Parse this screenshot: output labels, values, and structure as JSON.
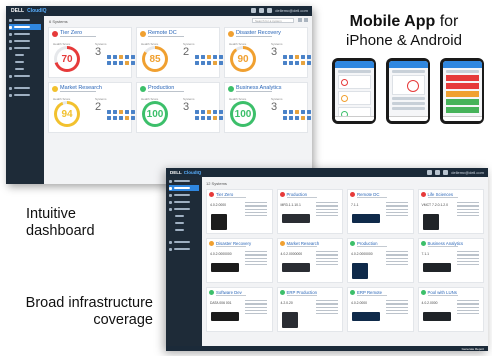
{
  "heading": {
    "bold": "Mobile App",
    "rest": " for",
    "line2": "iPhone & Android"
  },
  "captions": {
    "intuitive": [
      "Intuitive",
      "dashboard"
    ],
    "broad": [
      "Broad infrastructure",
      "coverage"
    ]
  },
  "brand": {
    "name": "DELL",
    "product": "CloudIQ"
  },
  "dash1": {
    "count": "6 Systems",
    "search_placeholder": "Search for a system",
    "sort": "Sort",
    "user": "dellemc@dell.com",
    "health_label": "Health Score",
    "inv_label": "Systems",
    "cards": [
      {
        "name": "Tier Zero",
        "score": "70",
        "inv": "3",
        "color": "#e63a3a"
      },
      {
        "name": "Remote DC",
        "score": "85",
        "inv": "2",
        "color": "#f0a030"
      },
      {
        "name": "Disaster Recovery",
        "score": "90",
        "inv": "3",
        "color": "#f0a030"
      },
      {
        "name": "Market Research",
        "score": "94",
        "inv": "2",
        "color": "#f2c12e"
      },
      {
        "name": "Production",
        "score": "100",
        "inv": "3",
        "color": "#3cbf6a"
      },
      {
        "name": "Business Analytics",
        "score": "100",
        "inv": "3",
        "color": "#3cbf6a"
      }
    ]
  },
  "dash2": {
    "count": "12 Systems",
    "footer_button": "Generate Report",
    "cards": [
      {
        "name": "Tier Zero",
        "ver": "4.0.2.0000",
        "color": "#e63a3a"
      },
      {
        "name": "Production",
        "ver": "MR3.1.1.10.1",
        "color": "#e63a3a"
      },
      {
        "name": "Remote DC",
        "ver": "7.1.1",
        "color": "#e63a3a"
      },
      {
        "name": "Life Sciences",
        "ver": "VMCT 7.2.0.1.2.0",
        "color": "#e63a3a"
      },
      {
        "name": "Disaster Recovery",
        "ver": "4.0.2.0000000",
        "color": "#f0a030"
      },
      {
        "name": "Market Research",
        "ver": "4.0.2.0000000",
        "color": "#f0a030"
      },
      {
        "name": "Production",
        "ver": "4.0.2.0000000",
        "color": "#3cbf6a"
      },
      {
        "name": "Business Analytics",
        "ver": "7.1.1",
        "color": "#3cbf6a"
      },
      {
        "name": "Software Dev",
        "ver": "DATA 006 001",
        "color": "#3cbf6a"
      },
      {
        "name": "ERP Production",
        "ver": "4.2.0.20",
        "color": "#3cbf6a"
      },
      {
        "name": "ERP Remote",
        "ver": "4.0.2.0000",
        "color": "#3cbf6a"
      },
      {
        "name": "Pool with LUNs",
        "ver": "4.0.2.0000",
        "color": "#3cbf6a"
      }
    ]
  }
}
